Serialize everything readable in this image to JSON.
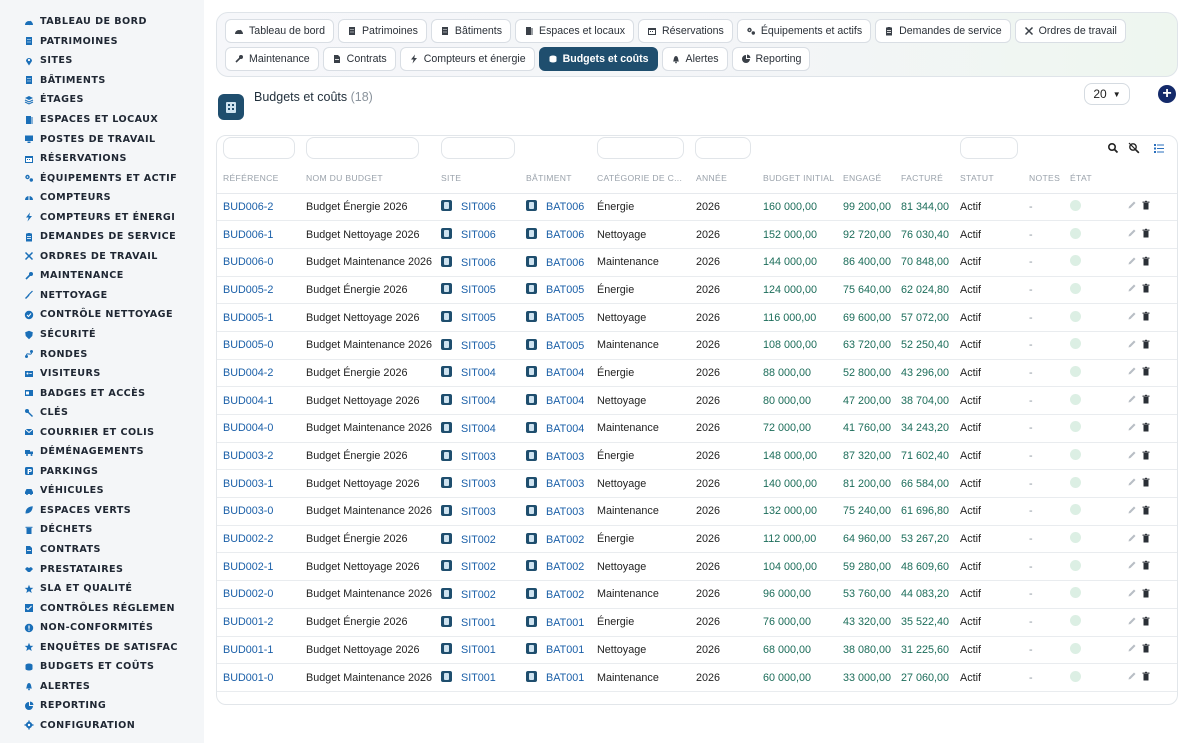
{
  "sidebar": {
    "items": [
      {
        "label": "TABLEAU DE BORD",
        "icon": "dashboard-icon"
      },
      {
        "label": "PATRIMOINES",
        "icon": "building-icon"
      },
      {
        "label": "SITES",
        "icon": "location-icon"
      },
      {
        "label": "BÂTIMENTS",
        "icon": "building-icon"
      },
      {
        "label": "ÉTAGES",
        "icon": "layers-icon"
      },
      {
        "label": "ESPACES ET LOCAUX",
        "icon": "door-icon"
      },
      {
        "label": "POSTES DE TRAVAIL",
        "icon": "desktop-icon"
      },
      {
        "label": "RÉSERVATIONS",
        "icon": "calendar-icon"
      },
      {
        "label": "ÉQUIPEMENTS ET ACTIF",
        "icon": "gears-icon"
      },
      {
        "label": "COMPTEURS",
        "icon": "gauge-icon"
      },
      {
        "label": "COMPTEURS ET ÉNERGI",
        "icon": "bolt-icon"
      },
      {
        "label": "DEMANDES DE SERVICE",
        "icon": "clipboard-icon"
      },
      {
        "label": "ORDRES DE TRAVAIL",
        "icon": "tools-icon"
      },
      {
        "label": "MAINTENANCE",
        "icon": "wrench-icon"
      },
      {
        "label": "NETTOYAGE",
        "icon": "broom-icon"
      },
      {
        "label": "CONTRÔLE NETTOYAGE",
        "icon": "check-icon"
      },
      {
        "label": "SÉCURITÉ",
        "icon": "shield-icon"
      },
      {
        "label": "RONDES",
        "icon": "route-icon"
      },
      {
        "label": "VISITEURS",
        "icon": "id-card-icon"
      },
      {
        "label": "BADGES ET ACCÈS",
        "icon": "badge-icon"
      },
      {
        "label": "CLÉS",
        "icon": "key-icon"
      },
      {
        "label": "COURRIER ET COLIS",
        "icon": "mail-icon"
      },
      {
        "label": "DÉMÉNAGEMENTS",
        "icon": "truck-icon"
      },
      {
        "label": "PARKINGS",
        "icon": "parking-icon"
      },
      {
        "label": "VÉHICULES",
        "icon": "car-icon"
      },
      {
        "label": "ESPACES VERTS",
        "icon": "leaf-icon"
      },
      {
        "label": "DÉCHETS",
        "icon": "trash-icon"
      },
      {
        "label": "CONTRATS",
        "icon": "document-icon"
      },
      {
        "label": "PRESTATAIRES",
        "icon": "handshake-icon"
      },
      {
        "label": "SLA ET QUALITÉ",
        "icon": "star-icon"
      },
      {
        "label": "CONTRÔLES RÉGLEMEN",
        "icon": "checklist-icon"
      },
      {
        "label": "NON-CONFORMITÉS",
        "icon": "warning-icon"
      },
      {
        "label": "ENQUÊTES DE SATISFAC",
        "icon": "star-icon"
      },
      {
        "label": "BUDGETS ET COÛTS",
        "icon": "coins-icon"
      },
      {
        "label": "ALERTES",
        "icon": "bell-icon"
      },
      {
        "label": "REPORTING",
        "icon": "chart-pie-icon"
      },
      {
        "label": "CONFIGURATION",
        "icon": "gear-icon"
      }
    ]
  },
  "tabs": {
    "row1": [
      {
        "label": "Tableau de bord",
        "icon": "dashboard-icon"
      },
      {
        "label": "Patrimoines",
        "icon": "building-icon"
      },
      {
        "label": "Bâtiments",
        "icon": "building-icon"
      },
      {
        "label": "Espaces et locaux",
        "icon": "door-icon"
      },
      {
        "label": "Réservations",
        "icon": "calendar-icon"
      },
      {
        "label": "Équipements et actifs",
        "icon": "gears-icon"
      },
      {
        "label": "Demandes de service",
        "icon": "clipboard-icon"
      },
      {
        "label": "Ordres de travail",
        "icon": "tools-icon"
      }
    ],
    "row2": [
      {
        "label": "Maintenance",
        "icon": "wrench-icon"
      },
      {
        "label": "Contrats",
        "icon": "document-icon"
      },
      {
        "label": "Compteurs et énergie",
        "icon": "bolt-icon"
      },
      {
        "label": "Budgets et coûts",
        "icon": "coins-icon",
        "active": true
      },
      {
        "label": "Alertes",
        "icon": "bell-icon"
      },
      {
        "label": "Reporting",
        "icon": "chart-pie-icon"
      }
    ]
  },
  "page": {
    "title": "Budgets et coûts",
    "count": "(18)",
    "page_size": "20",
    "add_label": "+"
  },
  "table": {
    "columns": [
      "RÉFÉRENCE",
      "NOM DU BUDGET",
      "SITE",
      "BÂTIMENT",
      "CATÉGORIE DE C...",
      "ANNÉE",
      "BUDGET INITIAL",
      "ENGAGÉ",
      "FACTURÉ",
      "STATUT",
      "NOTES",
      "ÉTAT",
      ""
    ],
    "rows": [
      {
        "ref": "BUD006-2",
        "name": "Budget Énergie 2026",
        "site": "SIT006",
        "bat": "BAT006",
        "cat": "Énergie",
        "year": "2026",
        "init": "160 000,00",
        "eng": "99 200,00",
        "fact": "81 344,00",
        "status": "Actif",
        "notes": "-"
      },
      {
        "ref": "BUD006-1",
        "name": "Budget Nettoyage 2026",
        "site": "SIT006",
        "bat": "BAT006",
        "cat": "Nettoyage",
        "year": "2026",
        "init": "152 000,00",
        "eng": "92 720,00",
        "fact": "76 030,40",
        "status": "Actif",
        "notes": "-"
      },
      {
        "ref": "BUD006-0",
        "name": "Budget Maintenance 2026",
        "site": "SIT006",
        "bat": "BAT006",
        "cat": "Maintenance",
        "year": "2026",
        "init": "144 000,00",
        "eng": "86 400,00",
        "fact": "70 848,00",
        "status": "Actif",
        "notes": "-"
      },
      {
        "ref": "BUD005-2",
        "name": "Budget Énergie 2026",
        "site": "SIT005",
        "bat": "BAT005",
        "cat": "Énergie",
        "year": "2026",
        "init": "124 000,00",
        "eng": "75 640,00",
        "fact": "62 024,80",
        "status": "Actif",
        "notes": "-"
      },
      {
        "ref": "BUD005-1",
        "name": "Budget Nettoyage 2026",
        "site": "SIT005",
        "bat": "BAT005",
        "cat": "Nettoyage",
        "year": "2026",
        "init": "116 000,00",
        "eng": "69 600,00",
        "fact": "57 072,00",
        "status": "Actif",
        "notes": "-"
      },
      {
        "ref": "BUD005-0",
        "name": "Budget Maintenance 2026",
        "site": "SIT005",
        "bat": "BAT005",
        "cat": "Maintenance",
        "year": "2026",
        "init": "108 000,00",
        "eng": "63 720,00",
        "fact": "52 250,40",
        "status": "Actif",
        "notes": "-"
      },
      {
        "ref": "BUD004-2",
        "name": "Budget Énergie 2026",
        "site": "SIT004",
        "bat": "BAT004",
        "cat": "Énergie",
        "year": "2026",
        "init": "88 000,00",
        "eng": "52 800,00",
        "fact": "43 296,00",
        "status": "Actif",
        "notes": "-"
      },
      {
        "ref": "BUD004-1",
        "name": "Budget Nettoyage 2026",
        "site": "SIT004",
        "bat": "BAT004",
        "cat": "Nettoyage",
        "year": "2026",
        "init": "80 000,00",
        "eng": "47 200,00",
        "fact": "38 704,00",
        "status": "Actif",
        "notes": "-"
      },
      {
        "ref": "BUD004-0",
        "name": "Budget Maintenance 2026",
        "site": "SIT004",
        "bat": "BAT004",
        "cat": "Maintenance",
        "year": "2026",
        "init": "72 000,00",
        "eng": "41 760,00",
        "fact": "34 243,20",
        "status": "Actif",
        "notes": "-"
      },
      {
        "ref": "BUD003-2",
        "name": "Budget Énergie 2026",
        "site": "SIT003",
        "bat": "BAT003",
        "cat": "Énergie",
        "year": "2026",
        "init": "148 000,00",
        "eng": "87 320,00",
        "fact": "71 602,40",
        "status": "Actif",
        "notes": "-"
      },
      {
        "ref": "BUD003-1",
        "name": "Budget Nettoyage 2026",
        "site": "SIT003",
        "bat": "BAT003",
        "cat": "Nettoyage",
        "year": "2026",
        "init": "140 000,00",
        "eng": "81 200,00",
        "fact": "66 584,00",
        "status": "Actif",
        "notes": "-"
      },
      {
        "ref": "BUD003-0",
        "name": "Budget Maintenance 2026",
        "site": "SIT003",
        "bat": "BAT003",
        "cat": "Maintenance",
        "year": "2026",
        "init": "132 000,00",
        "eng": "75 240,00",
        "fact": "61 696,80",
        "status": "Actif",
        "notes": "-"
      },
      {
        "ref": "BUD002-2",
        "name": "Budget Énergie 2026",
        "site": "SIT002",
        "bat": "BAT002",
        "cat": "Énergie",
        "year": "2026",
        "init": "112 000,00",
        "eng": "64 960,00",
        "fact": "53 267,20",
        "status": "Actif",
        "notes": "-"
      },
      {
        "ref": "BUD002-1",
        "name": "Budget Nettoyage 2026",
        "site": "SIT002",
        "bat": "BAT002",
        "cat": "Nettoyage",
        "year": "2026",
        "init": "104 000,00",
        "eng": "59 280,00",
        "fact": "48 609,60",
        "status": "Actif",
        "notes": "-"
      },
      {
        "ref": "BUD002-0",
        "name": "Budget Maintenance 2026",
        "site": "SIT002",
        "bat": "BAT002",
        "cat": "Maintenance",
        "year": "2026",
        "init": "96 000,00",
        "eng": "53 760,00",
        "fact": "44 083,20",
        "status": "Actif",
        "notes": "-"
      },
      {
        "ref": "BUD001-2",
        "name": "Budget Énergie 2026",
        "site": "SIT001",
        "bat": "BAT001",
        "cat": "Énergie",
        "year": "2026",
        "init": "76 000,00",
        "eng": "43 320,00",
        "fact": "35 522,40",
        "status": "Actif",
        "notes": "-"
      },
      {
        "ref": "BUD001-1",
        "name": "Budget Nettoyage 2026",
        "site": "SIT001",
        "bat": "BAT001",
        "cat": "Nettoyage",
        "year": "2026",
        "init": "68 000,00",
        "eng": "38 080,00",
        "fact": "31 225,60",
        "status": "Actif",
        "notes": "-"
      },
      {
        "ref": "BUD001-0",
        "name": "Budget Maintenance 2026",
        "site": "SIT001",
        "bat": "BAT001",
        "cat": "Maintenance",
        "year": "2026",
        "init": "60 000,00",
        "eng": "33 000,00",
        "fact": "27 060,00",
        "status": "Actif",
        "notes": "-"
      }
    ]
  },
  "colors": {
    "accent": "#1f4e6e",
    "link": "#1a5fa8",
    "amount": "#1c6d5a",
    "status_dot": "#dcefe4"
  }
}
